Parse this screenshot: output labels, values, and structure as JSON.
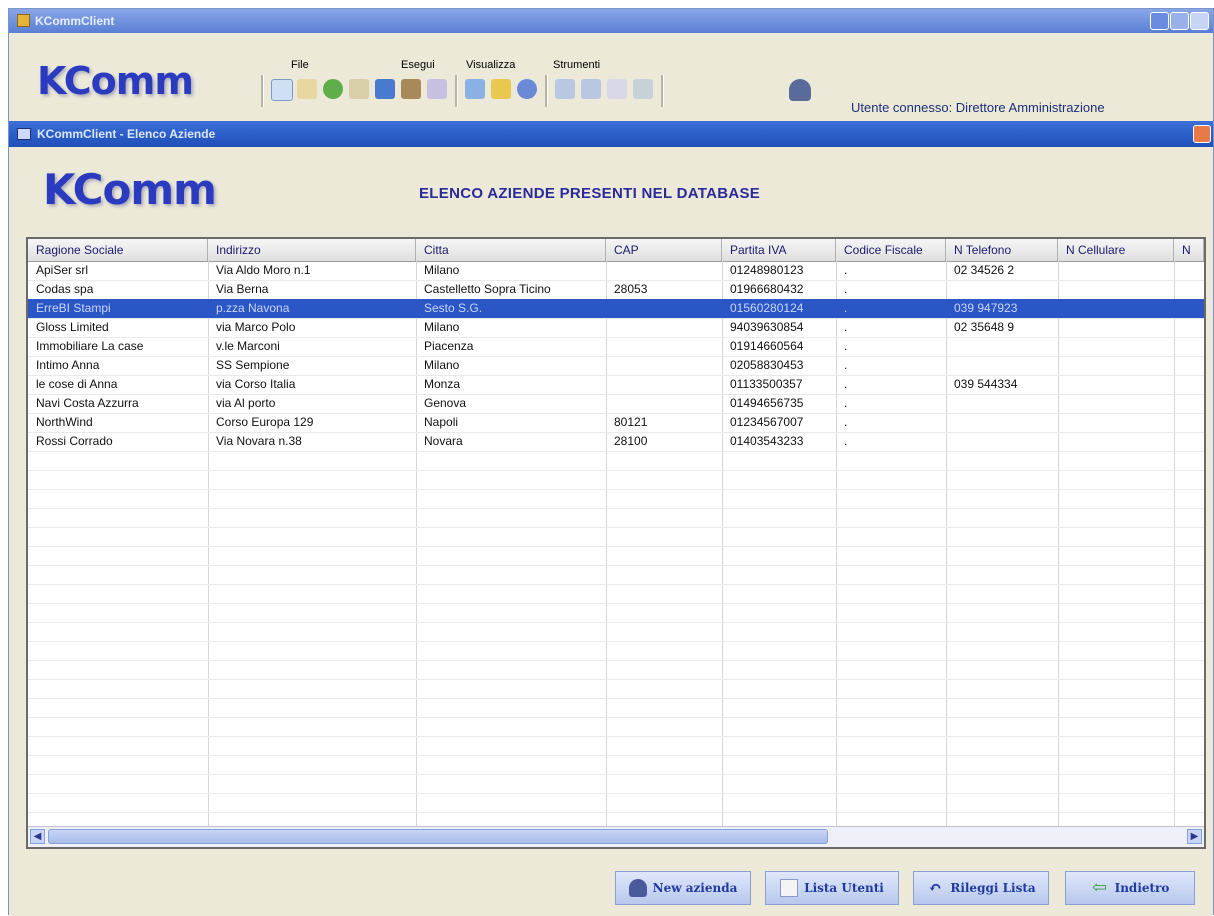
{
  "window": {
    "title": "KCommClient"
  },
  "logo": {
    "text": "KComm"
  },
  "menu": [
    "File",
    "Esegui",
    "Visualizza",
    "Strumenti"
  ],
  "status": {
    "user_label": "Utente connesso: Direttore Amministrazione"
  },
  "inner_window": {
    "title": "KCommClient - Elenco Aziende"
  },
  "page": {
    "heading": "ELENCO AZIENDE PRESENTI NEL DATABASE"
  },
  "table": {
    "columns": [
      "Ragione Sociale",
      "Indirizzo",
      "Citta",
      "CAP",
      "Partita IVA",
      "Codice Fiscale",
      "N Telefono",
      "N Cellulare",
      "N"
    ],
    "rows": [
      [
        "ApiSer srl",
        "Via Aldo Moro n.1",
        "Milano",
        "",
        "01248980123",
        ".",
        "02 34526 2",
        ""
      ],
      [
        "Codas spa",
        "Via Berna",
        "Castelletto Sopra Ticino",
        "28053",
        "01966680432",
        ".",
        "",
        ""
      ],
      [
        "ErreBI Stampi",
        "p.zza Navona",
        "Sesto S.G.",
        "",
        "01560280124",
        ".",
        "039 947923",
        ""
      ],
      [
        "Gloss Limited",
        "via Marco Polo",
        "Milano",
        "",
        "94039630854",
        ".",
        "02 35648 9",
        ""
      ],
      [
        "Immobiliare La case",
        "v.le Marconi",
        "Piacenza",
        "",
        "01914660564",
        ".",
        "",
        ""
      ],
      [
        "Intimo Anna",
        "SS Sempione",
        "Milano",
        "",
        "02058830453",
        ".",
        "",
        ""
      ],
      [
        "le cose di Anna",
        "via Corso Italia",
        "Monza",
        "",
        "01133500357",
        ".",
        "039 544334",
        ""
      ],
      [
        "Navi Costa Azzurra",
        "via Al porto",
        "Genova",
        "",
        "01494656735",
        ".",
        "",
        ""
      ],
      [
        "NorthWind",
        "Corso Europa 129",
        "Napoli",
        "80121",
        "01234567007",
        ".",
        "",
        ""
      ],
      [
        "Rossi Corrado",
        "Via Novara n.38",
        "Novara",
        "28100",
        "01403543233",
        ".",
        "",
        ""
      ]
    ],
    "selected_index": 2
  },
  "buttons": {
    "new_azienda": "New azienda",
    "lista_utenti": "Lista Utenti",
    "rileggi_lista": "Rileggi Lista",
    "indietro": "Indietro"
  },
  "colors": {
    "accent": "#2a56c6",
    "heading": "#2a2a9a",
    "titlebar": "#5a7fd6"
  }
}
